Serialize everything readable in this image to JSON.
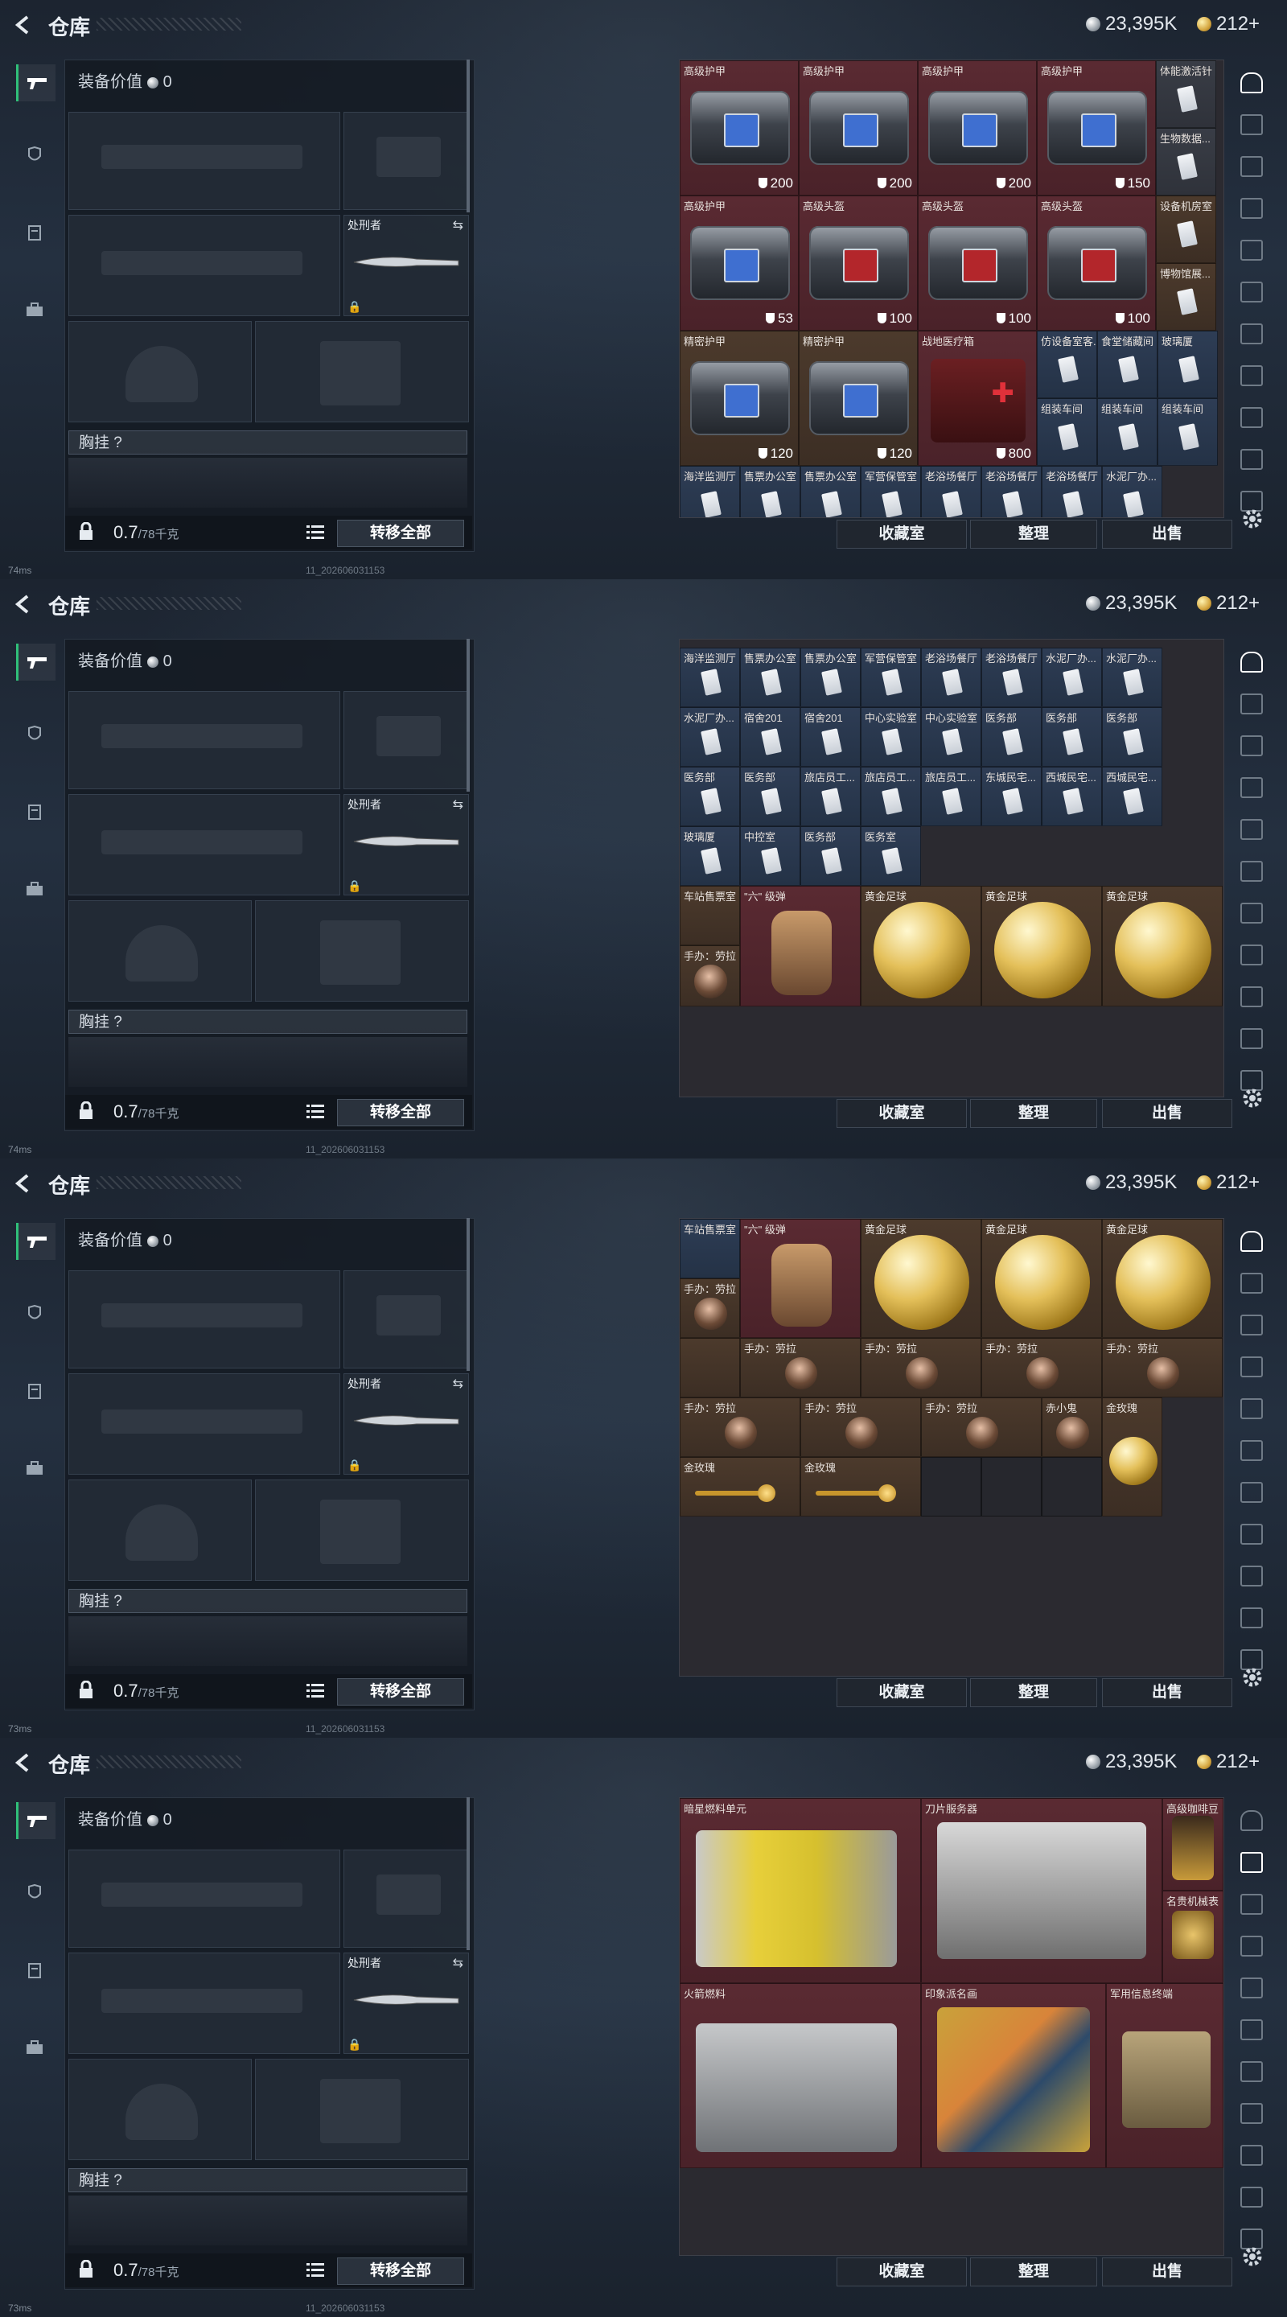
{
  "header": {
    "title": "仓库",
    "currency1": "23,395K",
    "currency2": "212+"
  },
  "loadout": {
    "equip_value_label": "装备价值",
    "equip_value": "0",
    "knife_name": "处刑者",
    "chest_label": "胸挂 ?",
    "weight": "0.7",
    "weight_max": "/78千克",
    "transfer_all": "转移全部"
  },
  "bottom_buttons": {
    "collection": "收藏室",
    "sort": "整理",
    "sell": "出售"
  },
  "status": {
    "ping1": "74ms",
    "ping2": "74ms",
    "ping3": "73ms",
    "ping4": "73ms",
    "version": "11_202606031153"
  },
  "panels": [
    {
      "cells": [
        {
          "name": "高级护甲",
          "value": "200",
          "bg": "red",
          "art": "bag"
        },
        {
          "name": "高级护甲",
          "value": "200",
          "bg": "red",
          "art": "bag"
        },
        {
          "name": "高级护甲",
          "value": "200",
          "bg": "red",
          "art": "bag"
        },
        {
          "name": "高级护甲",
          "value": "150",
          "bg": "red",
          "art": "bag"
        },
        {
          "name": "体能激活针",
          "value": "",
          "bg": "gray",
          "art": "card"
        },
        {
          "name": "生物数据...",
          "value": "",
          "bg": "gray",
          "art": "card"
        },
        {
          "name": "高级护甲",
          "value": "53",
          "bg": "red",
          "art": "bag"
        },
        {
          "name": "高级头盔",
          "value": "100",
          "bg": "red",
          "art": "helm"
        },
        {
          "name": "高级头盔",
          "value": "100",
          "bg": "red",
          "art": "helm"
        },
        {
          "name": "高级头盔",
          "value": "100",
          "bg": "red",
          "art": "helm"
        },
        {
          "name": "设备机房室",
          "value": "",
          "bg": "brown",
          "art": "card"
        },
        {
          "name": "博物馆展...",
          "value": "",
          "bg": "brown",
          "art": "card"
        },
        {
          "name": "精密护甲",
          "value": "120",
          "bg": "brown",
          "art": "bag"
        },
        {
          "name": "精密护甲",
          "value": "120",
          "bg": "brown",
          "art": "bag"
        },
        {
          "name": "战地医疗箱",
          "value": "800",
          "bg": "red",
          "art": "medkit"
        },
        {
          "name": "仿设备室客...",
          "value": "",
          "bg": "blue",
          "art": "card"
        },
        {
          "name": "食堂储藏间",
          "value": "",
          "bg": "blue",
          "art": "card"
        },
        {
          "name": "玻璃厦",
          "value": "",
          "bg": "blue",
          "art": "card"
        },
        {
          "name": "组装车间",
          "value": "",
          "bg": "blue",
          "art": "card"
        },
        {
          "name": "组装车间",
          "value": "",
          "bg": "blue",
          "art": "card"
        },
        {
          "name": "组装车间",
          "value": "",
          "bg": "blue",
          "art": "card"
        },
        {
          "name": "海洋监测厅",
          "value": "",
          "bg": "blue",
          "art": "card"
        },
        {
          "name": "售票办公室",
          "value": "",
          "bg": "blue",
          "art": "card"
        },
        {
          "name": "售票办公室",
          "value": "",
          "bg": "blue",
          "art": "card"
        },
        {
          "name": "军营保管室",
          "value": "",
          "bg": "blue",
          "art": "card"
        },
        {
          "name": "老浴场餐厅",
          "value": "",
          "bg": "blue",
          "art": "card"
        },
        {
          "name": "老浴场餐厅",
          "value": "",
          "bg": "blue",
          "art": "card"
        },
        {
          "name": "老浴场餐厅",
          "value": "",
          "bg": "blue",
          "art": "card"
        },
        {
          "name": "水泥厂办...",
          "value": "",
          "bg": "blue",
          "art": "card"
        }
      ]
    },
    {
      "cells": [
        {
          "name": "海洋监测厅",
          "value": "",
          "bg": "blue",
          "art": "card"
        },
        {
          "name": "售票办公室",
          "value": "",
          "bg": "blue",
          "art": "card"
        },
        {
          "name": "售票办公室",
          "value": "",
          "bg": "blue",
          "art": "card"
        },
        {
          "name": "军营保管室",
          "value": "",
          "bg": "blue",
          "art": "card"
        },
        {
          "name": "老浴场餐厅",
          "value": "",
          "bg": "blue",
          "art": "card"
        },
        {
          "name": "老浴场餐厅",
          "value": "",
          "bg": "blue",
          "art": "card"
        },
        {
          "name": "水泥厂办...",
          "value": "",
          "bg": "blue",
          "art": "card"
        },
        {
          "name": "水泥厂办...",
          "value": "",
          "bg": "blue",
          "art": "card"
        },
        {
          "name": "水泥厂办...",
          "value": "",
          "bg": "blue",
          "art": "card"
        },
        {
          "name": "宿舍201",
          "value": "",
          "bg": "blue",
          "art": "card"
        },
        {
          "name": "宿舍201",
          "value": "",
          "bg": "blue",
          "art": "card"
        },
        {
          "name": "中心实验室",
          "value": "",
          "bg": "blue",
          "art": "card"
        },
        {
          "name": "中心实验室",
          "value": "",
          "bg": "blue",
          "art": "card"
        },
        {
          "name": "医务部",
          "value": "",
          "bg": "blue",
          "art": "card"
        },
        {
          "name": "医务部",
          "value": "",
          "bg": "blue",
          "art": "card"
        },
        {
          "name": "医务部",
          "value": "",
          "bg": "blue",
          "art": "card"
        },
        {
          "name": "医务部",
          "value": "",
          "bg": "blue",
          "art": "card"
        },
        {
          "name": "医务部",
          "value": "",
          "bg": "blue",
          "art": "card"
        },
        {
          "name": "旅店员工...",
          "value": "",
          "bg": "blue",
          "art": "card"
        },
        {
          "name": "旅店员工...",
          "value": "",
          "bg": "blue",
          "art": "card"
        },
        {
          "name": "旅店员工...",
          "value": "",
          "bg": "blue",
          "art": "card"
        },
        {
          "name": "东城民宅...",
          "value": "",
          "bg": "blue",
          "art": "card"
        },
        {
          "name": "西城民宅...",
          "value": "",
          "bg": "blue",
          "art": "card"
        },
        {
          "name": "西城民宅...",
          "value": "",
          "bg": "blue",
          "art": "card"
        },
        {
          "name": "玻璃厦",
          "value": "",
          "bg": "blue",
          "art": "card"
        },
        {
          "name": "中控室",
          "value": "",
          "bg": "blue",
          "art": "card"
        },
        {
          "name": "医务部",
          "value": "",
          "bg": "blue",
          "art": "card"
        },
        {
          "name": "医务室",
          "value": "",
          "bg": "blue",
          "art": "card"
        }
      ],
      "special": [
        {
          "name": "车站售票室",
          "bg": "brown"
        },
        {
          "name": "\"六\" 级弹",
          "bg": "red"
        },
        {
          "name": "黄金足球",
          "bg": "brown"
        },
        {
          "name": "黄金足球",
          "bg": "brown"
        },
        {
          "name": "黄金足球",
          "bg": "brown"
        },
        {
          "name": "手办：劳拉",
          "bg": "brown"
        }
      ]
    },
    {
      "cells": [
        {
          "name": "车站售票室",
          "bg": "blue"
        },
        {
          "name": "\"六\" 级弹",
          "bg": "red"
        },
        {
          "name": "黄金足球",
          "bg": "brown"
        },
        {
          "name": "黄金足球",
          "bg": "brown"
        },
        {
          "name": "黄金足球",
          "bg": "brown"
        },
        {
          "name": "手办：劳拉",
          "bg": "brown"
        },
        {
          "name": "手办：劳拉",
          "bg": "brown"
        },
        {
          "name": "手办：劳拉",
          "bg": "brown"
        },
        {
          "name": "手办：劳拉",
          "bg": "brown"
        },
        {
          "name": "手办：劳拉",
          "bg": "brown"
        },
        {
          "name": "手办：劳拉",
          "bg": "brown"
        },
        {
          "name": "手办：劳拉",
          "bg": "brown"
        },
        {
          "name": "手办：劳拉",
          "bg": "brown"
        },
        {
          "name": "赤小鬼",
          "bg": "brown"
        },
        {
          "name": "金玫瑰",
          "bg": "brown"
        },
        {
          "name": "金玫瑰",
          "bg": "brown"
        },
        {
          "name": "金玫瑰",
          "bg": "brown"
        }
      ]
    },
    {
      "cells": [
        {
          "name": "暗星燃料单元",
          "bg": "red"
        },
        {
          "name": "刀片服务器",
          "bg": "red"
        },
        {
          "name": "高级咖啡豆",
          "bg": "red"
        },
        {
          "name": "名贵机械表",
          "bg": "red"
        },
        {
          "name": "火箭燃料",
          "bg": "red"
        },
        {
          "name": "印象派名画",
          "bg": "red"
        },
        {
          "name": "军用信息终端",
          "bg": "red"
        }
      ]
    }
  ]
}
